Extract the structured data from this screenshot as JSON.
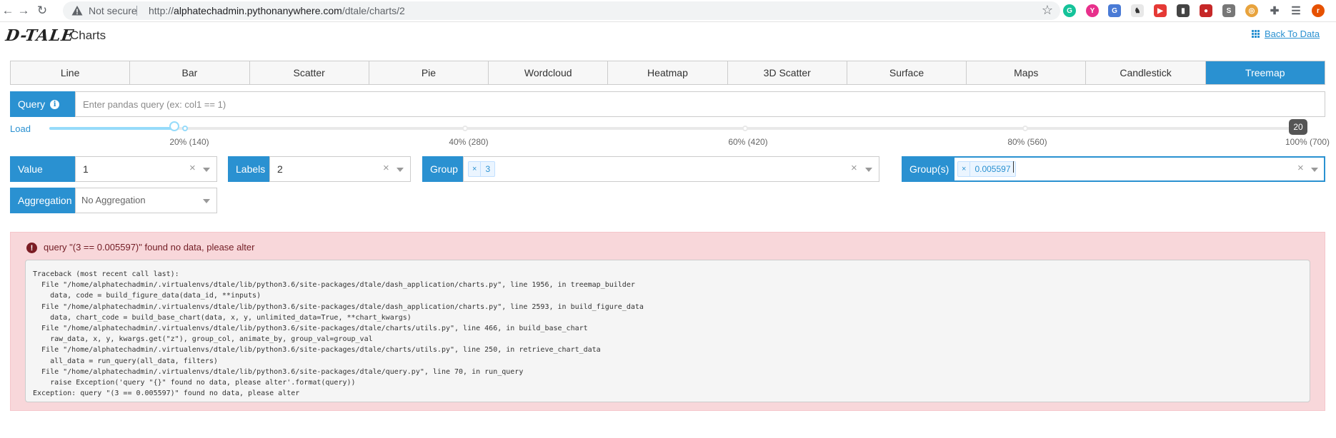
{
  "browser": {
    "not_secure": "Not secure",
    "url_scheme": "http://",
    "url_host": "alphatechadmin.pythonanywhere.com",
    "url_path": "/dtale/charts/2"
  },
  "header": {
    "logo": "D-TALE",
    "title": "Charts",
    "back_link": "Back To Data"
  },
  "tabs": [
    {
      "label": "Line",
      "active": false
    },
    {
      "label": "Bar",
      "active": false
    },
    {
      "label": "Scatter",
      "active": false
    },
    {
      "label": "Pie",
      "active": false
    },
    {
      "label": "Wordcloud",
      "active": false
    },
    {
      "label": "Heatmap",
      "active": false
    },
    {
      "label": "3D Scatter",
      "active": false
    },
    {
      "label": "Surface",
      "active": false
    },
    {
      "label": "Maps",
      "active": false
    },
    {
      "label": "Candlestick",
      "active": false
    },
    {
      "label": "Treemap",
      "active": true
    }
  ],
  "query": {
    "label": "Query",
    "info_icon": "i",
    "placeholder": "Enter pandas query (ex: col1 == 1)",
    "value": ""
  },
  "load": {
    "label": "Load",
    "value": 20,
    "tooltip": "20",
    "marks": [
      "20% (140)",
      "40% (280)",
      "60% (420)",
      "80% (560)",
      "100% (700)"
    ]
  },
  "value_select": {
    "label": "Value",
    "value": "1"
  },
  "labels_select": {
    "label": "Labels",
    "value": "2"
  },
  "group_select": {
    "label": "Group",
    "chips": [
      "3"
    ]
  },
  "groups_select": {
    "label": "Group(s)",
    "chips": [
      "0.005597"
    ]
  },
  "aggregation_select": {
    "label": "Aggregation",
    "placeholder": "No Aggregation"
  },
  "error": {
    "icon": "!",
    "message": "query \"(3 == 0.005597)\" found no data, please alter",
    "traceback": "Traceback (most recent call last):\n  File \"/home/alphatechadmin/.virtualenvs/dtale/lib/python3.6/site-packages/dtale/dash_application/charts.py\", line 1956, in treemap_builder\n    data, code = build_figure_data(data_id, **inputs)\n  File \"/home/alphatechadmin/.virtualenvs/dtale/lib/python3.6/site-packages/dtale/dash_application/charts.py\", line 2593, in build_figure_data\n    data, chart_code = build_base_chart(data, x, y, unlimited_data=True, **chart_kwargs)\n  File \"/home/alphatechadmin/.virtualenvs/dtale/lib/python3.6/site-packages/dtale/charts/utils.py\", line 466, in build_base_chart\n    raw_data, x, y, kwargs.get(\"z\"), group_col, animate_by, group_val=group_val\n  File \"/home/alphatechadmin/.virtualenvs/dtale/lib/python3.6/site-packages/dtale/charts/utils.py\", line 250, in retrieve_chart_data\n    all_data = run_query(all_data, filters)\n  File \"/home/alphatechadmin/.virtualenvs/dtale/lib/python3.6/site-packages/dtale/query.py\", line 70, in run_query\n    raise Exception('query \"{}\" found no data, please alter'.format(query))\nException: query \"(3 == 0.005597)\" found no data, please alter"
  },
  "colors": {
    "accent": "#2a91d1",
    "slider": "#96dbfa",
    "error_bg": "#f8d7da",
    "error_text": "#721c24"
  }
}
